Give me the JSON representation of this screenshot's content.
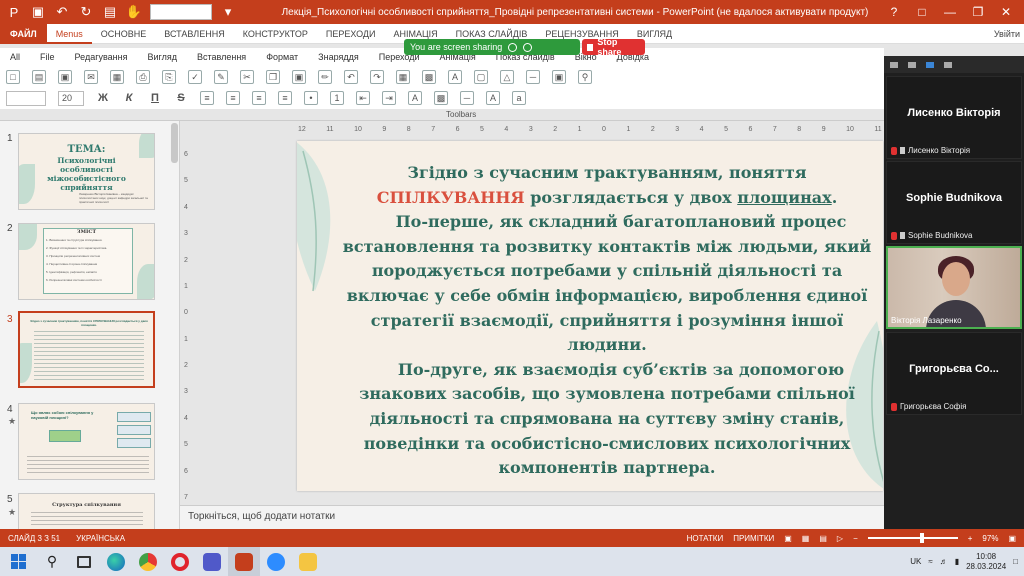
{
  "window": {
    "title": "Лекція_Психологічні особливості сприйняття_Провідні репрезентативні системи - PowerPoint (не вдалося активувати продукт)"
  },
  "tabs": [
    "ФАЙЛ",
    "Menus",
    "ОСНОВНЕ",
    "ВСТАВЛЕННЯ",
    "КОНСТРУКТОР",
    "ПЕРЕХОДИ",
    "АНІМАЦІЯ",
    "ПОКАЗ СЛАЙДІВ",
    "РЕЦЕНЗУВАННЯ",
    "ВИГЛЯД"
  ],
  "user_name": "Увійти",
  "screen_share": {
    "status": "You are screen sharing",
    "stop_label": "Stop share"
  },
  "menu": [
    "All",
    "File",
    "Редагування",
    "Вигляд",
    "Вставлення",
    "Формат",
    "Знаряддя",
    "Переходи",
    "Анімація",
    "Показ слайдів",
    "Вікно",
    "Довідка"
  ],
  "toolbar": {
    "font_size": "20",
    "bold": "Ж",
    "italic": "К",
    "underline": "П",
    "strike": "S",
    "group_label": "Toolbars"
  },
  "thumbnails": [
    {
      "num": "1",
      "title": "ТЕМА:",
      "subtitle": "Психологічні особливості міжособистісного сприйняття",
      "small": "Лазаренко Вікторія Іванівна – кандидат психологічних наук, доцент кафедри загальної та практичної психології"
    },
    {
      "num": "2",
      "title": "ЗМІСТ",
      "items": [
        "1. Визначення та структура спілкування.",
        "2. Функції спілкування та їх характеристика.",
        "3. Принципи репрезентативних систем",
        "4. Перцептивна сторона спілкування",
        "5. Ідентифікація, рефлексія, емпатія",
        "6. Репрезентативні системи особистості"
      ]
    },
    {
      "num": "3",
      "text": "Згідно з сучасним трактуванням, поняття СПІЛКУВАННЯ розглядається у двох площинах."
    },
    {
      "num": "4",
      "title": "Що являє собою спілкування у науковій площині?",
      "boxes": [
        "Передача інформації",
        "Сприйняття",
        "Взаємодія"
      ]
    },
    {
      "num": "5",
      "title": "Структура спілкування"
    }
  ],
  "slide": {
    "line1": "Згідно з сучасним трактуванням, поняття",
    "accent": "СПІЛКУВАННЯ",
    "line2a": " розглядається у двох ",
    "underlined": "площинах",
    "line2b": ".",
    "para1": "По-перше, як складний багатоплановий процес встановлення та розвитку контактів між людьми, який породжується потребами у спільній діяльності та включає у себе обмін інформацією, вироблення єдиної стратегії взаємодії, сприйняття і розуміння іншої людини.",
    "para2": "По-друге, як взаємодія суб’єктів за допомогою знакових засобів, що зумовлена потребами спільної діяльності та спрямована на суттєву зміну станів, поведінки та особистісно-смислових психологічних компонентів партнера."
  },
  "notes_placeholder": "Торкніться, щоб додати нотатки",
  "participants": [
    {
      "name": "Лисенко Вікторія",
      "label": "Лисенко Вікторія"
    },
    {
      "name": "Sophie Budnikova",
      "label": "Sophie Budnikova"
    },
    {
      "name": "",
      "label": "Вікторія Лазаренко"
    },
    {
      "name": "Григорьєва Со...",
      "label": "Григорьєва Софія"
    }
  ],
  "status": {
    "slide": "СЛАЙД 3 З 51",
    "language": "УКРАЇНСЬКА",
    "notes": "НОТАТКИ",
    "comments": "ПРИМІТКИ",
    "zoom": "97%"
  },
  "taskbar": {
    "lang": "UK",
    "time": "10:08",
    "date": "28.03.2024"
  },
  "colors": {
    "accent": "#c43e1c",
    "slide_text": "#2f6b5e",
    "highlight": "#d9503e",
    "share_green": "#2e9a3c",
    "stop_red": "#e03131"
  }
}
